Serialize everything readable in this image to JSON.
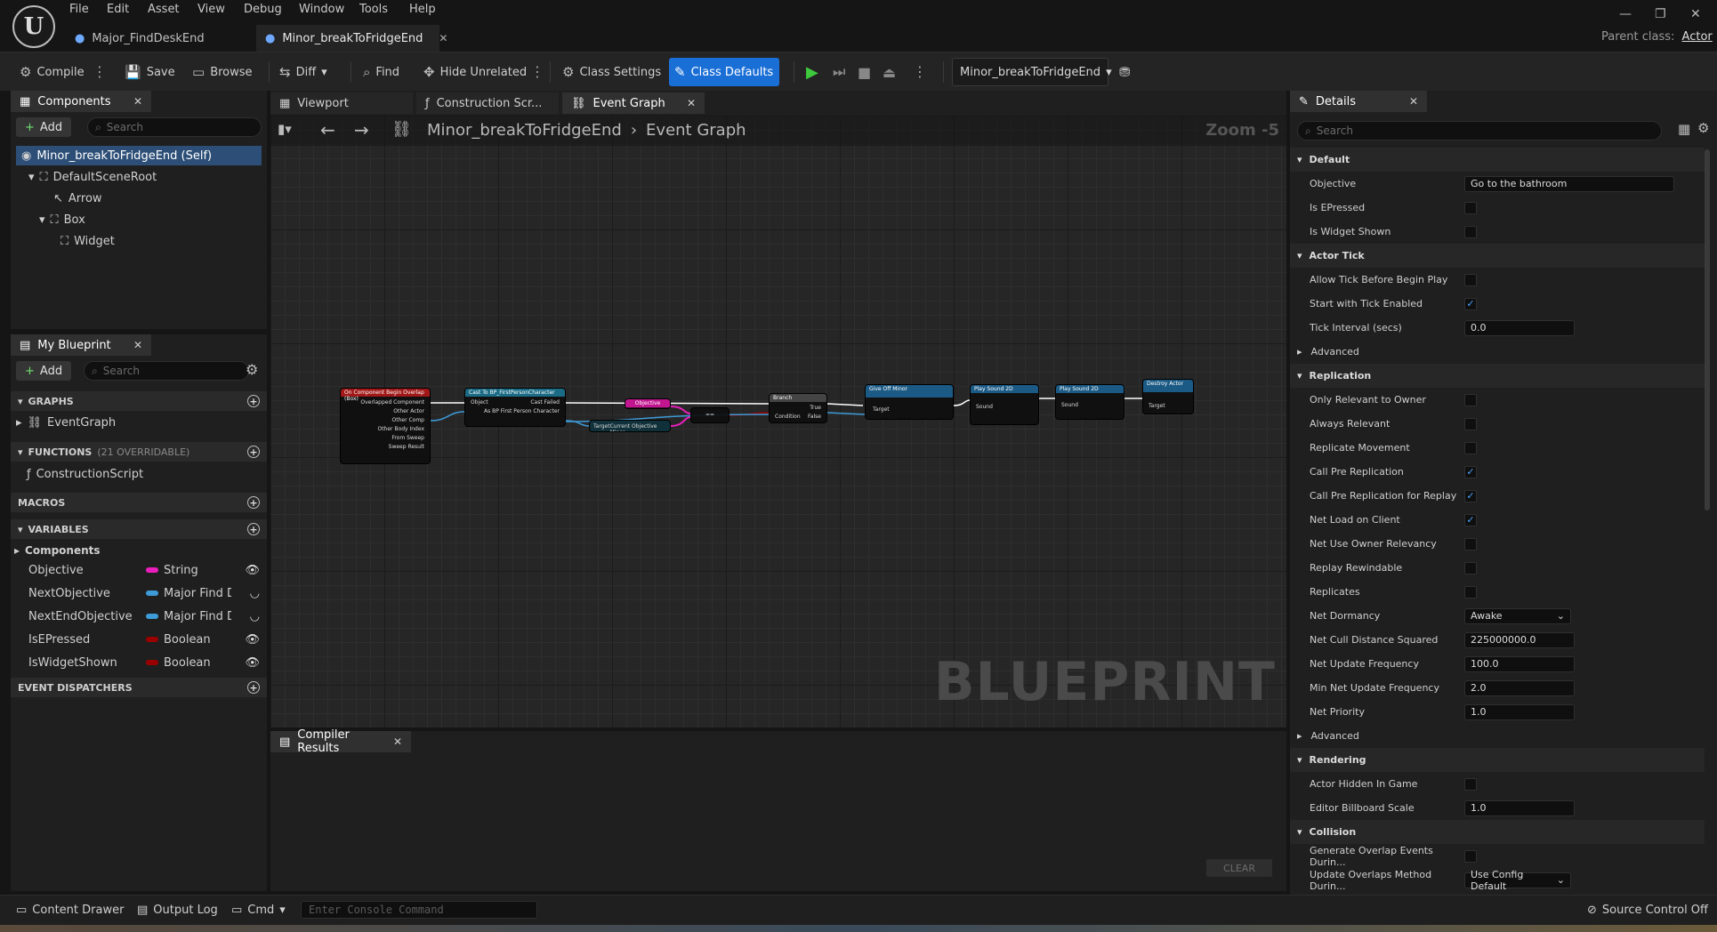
{
  "menus": [
    "File",
    "Edit",
    "Asset",
    "View",
    "Debug",
    "Window",
    "Tools",
    "Help"
  ],
  "doc_tabs": [
    {
      "label": "Major_FindDeskEnd",
      "active": false
    },
    {
      "label": "Minor_breakToFridgeEnd",
      "active": true
    }
  ],
  "parent_class": {
    "label": "Parent class:",
    "value": "Actor"
  },
  "toolbar": {
    "compile": "Compile",
    "save": "Save",
    "browse": "Browse",
    "diff": "Diff",
    "find": "Find",
    "hide_unrelated": "Hide Unrelated",
    "class_settings": "Class Settings",
    "class_defaults": "Class Defaults",
    "debug_object": "Minor_breakToFridgeEnd"
  },
  "components": {
    "tab": "Components",
    "add": "Add",
    "search_placeholder": "Search",
    "items": [
      {
        "label": "Minor_breakToFridgeEnd (Self)"
      },
      {
        "label": "DefaultSceneRoot"
      },
      {
        "label": "Arrow"
      },
      {
        "label": "Box"
      },
      {
        "label": "Widget"
      }
    ]
  },
  "my_blueprint": {
    "tab": "My Blueprint",
    "add": "Add",
    "search_placeholder": "Search",
    "graphs_header": "GRAPHS",
    "event_graph": "EventGraph",
    "functions_header": "FUNCTIONS",
    "functions_note": "(21 OVERRIDABLE)",
    "construction_script": "ConstructionScript",
    "macros_header": "MACROS",
    "variables_header": "VARIABLES",
    "components_group": "Components",
    "variables": [
      {
        "name": "Objective",
        "type": "String",
        "color": "#e91ebd",
        "icon": "eye"
      },
      {
        "name": "NextObjective",
        "type": "Major Find D",
        "color": "#3d9bd8",
        "icon": "eye-closed"
      },
      {
        "name": "NextEndObjective",
        "type": "Major Find D",
        "color": "#3d9bd8",
        "icon": "eye-closed"
      },
      {
        "name": "IsEPressed",
        "type": "Boolean",
        "color": "#9b0000",
        "icon": "eye"
      },
      {
        "name": "IsWidgetShown",
        "type": "Boolean",
        "color": "#9b0000",
        "icon": "eye"
      }
    ],
    "dispatchers_header": "EVENT DISPATCHERS"
  },
  "editor_tabs": [
    {
      "label": "Viewport",
      "active": false
    },
    {
      "label": "Construction Scr...",
      "active": false
    },
    {
      "label": "Event Graph",
      "active": true
    }
  ],
  "graph": {
    "breadcrumb_root": "Minor_breakToFridgeEnd",
    "breadcrumb_leaf": "Event Graph",
    "zoom": "Zoom -5",
    "watermark": "BLUEPRINT",
    "nodes": [
      {
        "title": "On Component Begin Overlap (Box)",
        "color": "#a01818",
        "pins": [
          "Overlapped Component",
          "Other Actor",
          "Other Comp",
          "Other Body Index",
          "From Sweep",
          "Sweep Result"
        ]
      },
      {
        "title": "Cast To BP_FirstPersonCharacter",
        "color": "#1b6b85",
        "pins": [
          "Object",
          "Cast Failed",
          "As BP First Person Character"
        ]
      },
      {
        "title": "Objective",
        "color": "#c1168f",
        "pins": []
      },
      {
        "title": "==",
        "color": "#2a2a2a",
        "pins": []
      },
      {
        "title": "",
        "color": "#1b6b85",
        "pins": [
          "Target",
          "Current Objective Minor"
        ]
      },
      {
        "title": "Branch",
        "color": "#444444",
        "pins": [
          "Condition",
          "True",
          "False"
        ]
      },
      {
        "title": "Give Off Minor",
        "color": "#1b5a85",
        "pins": [
          "Target"
        ]
      },
      {
        "title": "Play Sound 2D",
        "color": "#1b5a85",
        "pins": [
          "Sound"
        ]
      },
      {
        "title": "Play Sound 2D",
        "color": "#1b5a85",
        "pins": [
          "Sound"
        ]
      },
      {
        "title": "Destroy Actor",
        "color": "#1b5a85",
        "pins": [
          "Target"
        ]
      }
    ]
  },
  "compiler": {
    "tab": "Compiler Results",
    "clear": "CLEAR"
  },
  "details": {
    "tab": "Details",
    "search_placeholder": "Search",
    "sections": [
      {
        "title": "Default",
        "rows": [
          {
            "label": "Objective",
            "type": "text",
            "value": "Go to the bathroom"
          },
          {
            "label": "Is EPressed",
            "type": "check",
            "value": false
          },
          {
            "label": "Is Widget Shown",
            "type": "check",
            "value": false
          }
        ]
      },
      {
        "title": "Actor Tick",
        "rows": [
          {
            "label": "Allow Tick Before Begin Play",
            "type": "check",
            "value": false
          },
          {
            "label": "Start with Tick Enabled",
            "type": "check",
            "value": true
          },
          {
            "label": "Tick Interval (secs)",
            "type": "num",
            "value": "0.0"
          },
          {
            "label": "Advanced",
            "type": "sub"
          }
        ]
      },
      {
        "title": "Replication",
        "rows": [
          {
            "label": "Only Relevant to Owner",
            "type": "check",
            "value": false
          },
          {
            "label": "Always Relevant",
            "type": "check",
            "value": false
          },
          {
            "label": "Replicate Movement",
            "type": "check",
            "value": false
          },
          {
            "label": "Call Pre Replication",
            "type": "check",
            "value": true
          },
          {
            "label": "Call Pre Replication for Replay",
            "type": "check",
            "value": true
          },
          {
            "label": "Net Load on Client",
            "type": "check",
            "value": true
          },
          {
            "label": "Net Use Owner Relevancy",
            "type": "check",
            "value": false
          },
          {
            "label": "Replay Rewindable",
            "type": "check",
            "value": false
          },
          {
            "label": "Replicates",
            "type": "check",
            "value": false
          },
          {
            "label": "Net Dormancy",
            "type": "select",
            "value": "Awake"
          },
          {
            "label": "Net Cull Distance Squared",
            "type": "num",
            "value": "225000000.0"
          },
          {
            "label": "Net Update Frequency",
            "type": "num",
            "value": "100.0"
          },
          {
            "label": "Min Net Update Frequency",
            "type": "num",
            "value": "2.0"
          },
          {
            "label": "Net Priority",
            "type": "num",
            "value": "1.0"
          },
          {
            "label": "Advanced",
            "type": "sub"
          }
        ]
      },
      {
        "title": "Rendering",
        "rows": [
          {
            "label": "Actor Hidden In Game",
            "type": "check",
            "value": false
          },
          {
            "label": "Editor Billboard Scale",
            "type": "num",
            "value": "1.0"
          }
        ]
      },
      {
        "title": "Collision",
        "rows": [
          {
            "label": "Generate Overlap Events Durin...",
            "type": "check",
            "value": false
          },
          {
            "label": "Update Overlaps Method Durin...",
            "type": "select",
            "value": "Use Config Default"
          }
        ]
      }
    ]
  },
  "statusbar": {
    "content_drawer": "Content Drawer",
    "output_log": "Output Log",
    "cmd": "Cmd",
    "console_placeholder": "Enter Console Command",
    "source_control": "Source Control Off"
  }
}
